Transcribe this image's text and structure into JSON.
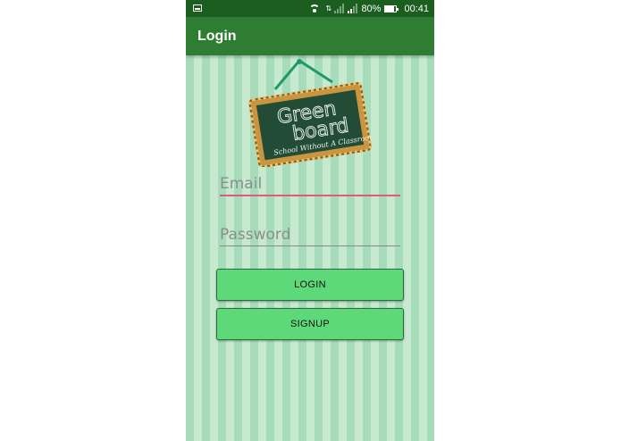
{
  "status_bar": {
    "battery": "80%",
    "time": "00:41"
  },
  "app_bar": {
    "title": "Login"
  },
  "logo": {
    "line1": "Green",
    "line2": "board",
    "tagline": "School Without A Classroom"
  },
  "form": {
    "email_placeholder": "Email",
    "password_placeholder": "Password"
  },
  "buttons": {
    "login": "LOGIN",
    "signup": "SIGNUP"
  },
  "colors": {
    "status_bar": "#1b5e20",
    "app_bar": "#2e7d32",
    "stripe_dark": "#a6dcb9",
    "stripe_light": "#c6e9d0",
    "button": "#5ed97a",
    "focus_underline": "#e05a7a",
    "chalkboard": "#234c37"
  }
}
